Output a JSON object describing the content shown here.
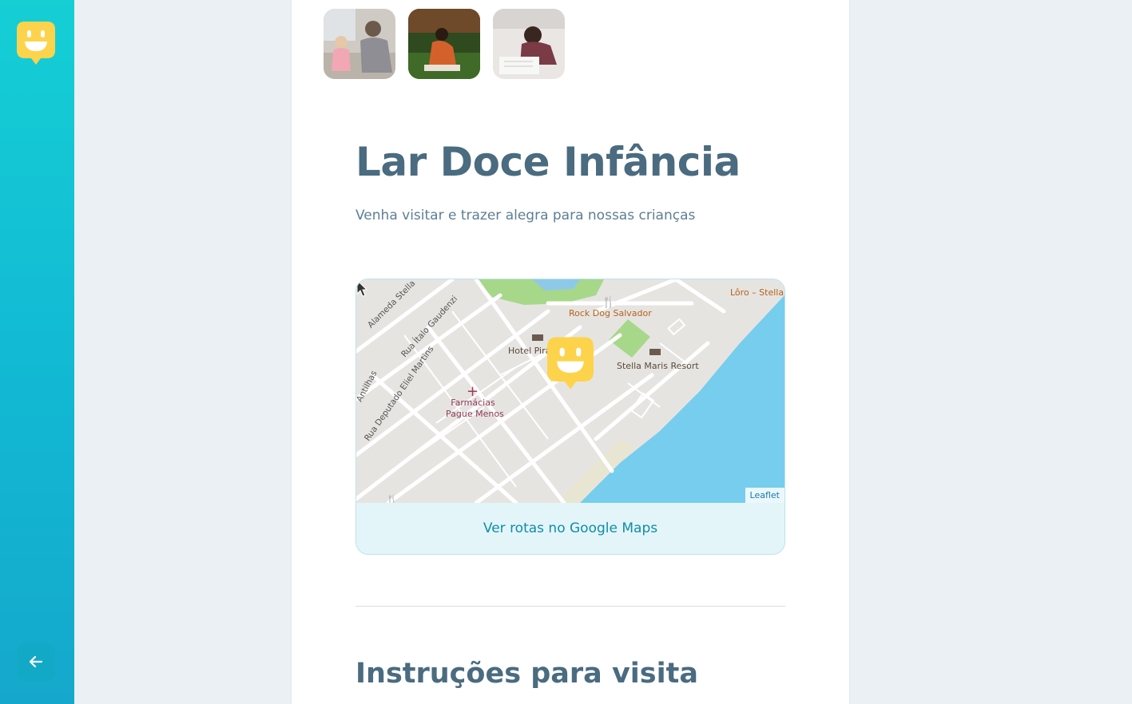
{
  "app": {
    "logo_icon": "smiley-logo-icon",
    "back_icon": "arrow-left-icon",
    "accent_color": "#14c3d4",
    "brand_yellow": "#fdd34c"
  },
  "gallery": {
    "photos": [
      {
        "icon": "photo-child-playing-icon"
      },
      {
        "icon": "photo-child-drawing-grass-icon"
      },
      {
        "icon": "photo-child-writing-icon"
      }
    ]
  },
  "place": {
    "title": "Lar Doce Infância",
    "subtitle": "Venha visitar e trazer alegra para nossas crianças"
  },
  "map": {
    "streets": [
      "Alameda Stella",
      "Rua Ítalo Gaudenzi",
      "Rua Deputado Eliel Martins",
      "Antilhas"
    ],
    "pois": {
      "rock_dog": "Rock Dog Salvador",
      "hotel": "Hotel Pira",
      "stella_maris": "Stella Maris Resort",
      "loro": "Lôro – Stella",
      "pharmacy_line1": "Farmácias",
      "pharmacy_line2": "Pague Menos"
    },
    "attribution": "Leaflet",
    "directions_label": "Ver rotas no Google Maps"
  },
  "instructions": {
    "heading": "Instruções para visita"
  }
}
